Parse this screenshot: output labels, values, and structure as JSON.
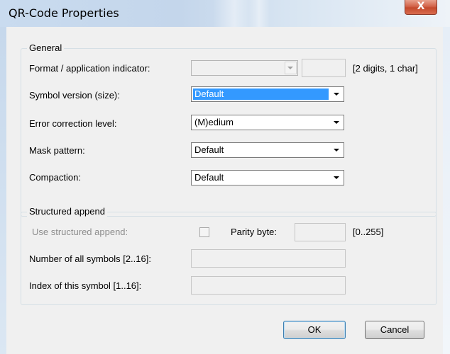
{
  "window": {
    "title": "QR-Code Properties",
    "close_glyph": "X"
  },
  "general": {
    "legend": "General",
    "format": {
      "label": "Format / application indicator:",
      "combo_value": "",
      "field_value": "",
      "hint": "[2 digits, 1 char]"
    },
    "symbol_version": {
      "label": "Symbol version (size):",
      "value": "Default"
    },
    "error_correction": {
      "label": "Error correction level:",
      "value": "(M)edium"
    },
    "mask_pattern": {
      "label": "Mask pattern:",
      "value": "Default"
    },
    "compaction": {
      "label": "Compaction:",
      "value": "Default"
    }
  },
  "structured_append": {
    "legend": "Structured append",
    "use_label": "Use structured append:",
    "use_checked": false,
    "parity_label": "Parity byte:",
    "parity_value": "",
    "parity_range": "[0..255]",
    "num_symbols_label": "Number of all symbols [2..16]:",
    "num_symbols_value": "",
    "index_label": "Index of this symbol [1..16]:",
    "index_value": ""
  },
  "buttons": {
    "ok": "OK",
    "cancel": "Cancel"
  },
  "colors": {
    "selection": "#3399ff",
    "close": "#c44a2c",
    "dialog_bg": "#f0f0f0"
  }
}
